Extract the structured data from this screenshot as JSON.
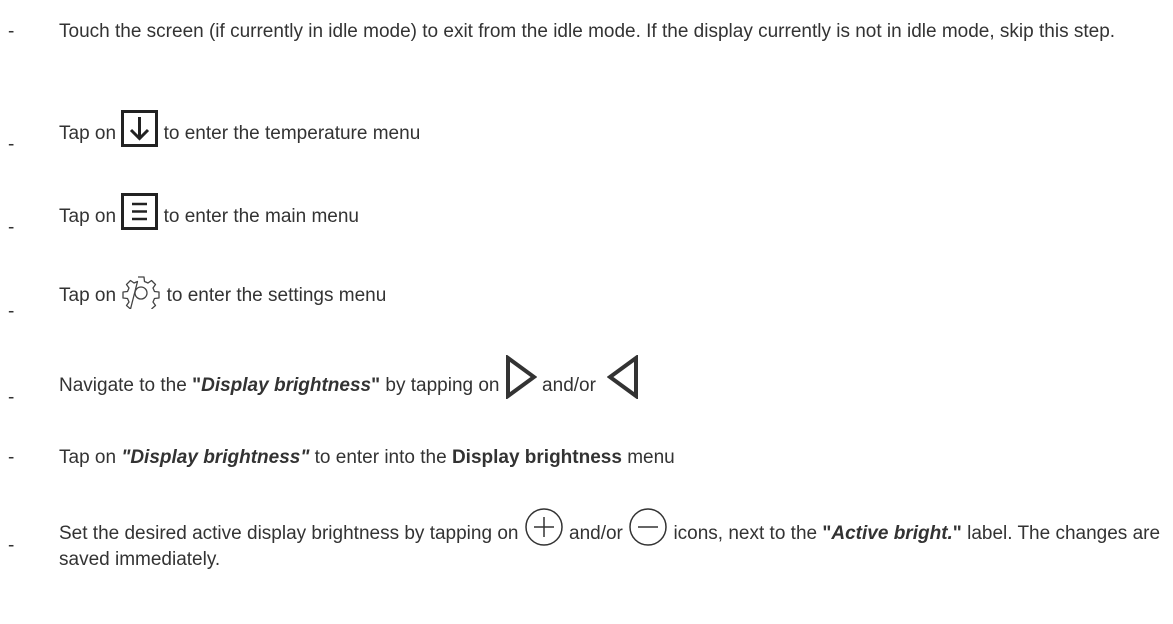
{
  "steps": [
    {
      "text": "Touch the screen (if currently in idle mode) to exit from the idle mode. If the display currently is not in idle mode, skip this step."
    },
    {
      "pre": "Tap on ",
      "icon": "arrow-down-icon",
      "post": " to enter the temperature menu"
    },
    {
      "pre": "Tap on ",
      "icon": "menu-icon",
      "post": " to enter the main menu"
    },
    {
      "pre": "Tap on ",
      "icon": "gear-icon",
      "post": " to enter the settings menu"
    },
    {
      "pre": "Navigate to the ",
      "quote_open": "\"",
      "em": "Display brightness",
      "quote_close": "\"",
      "mid": " by tapping on ",
      "icon1": "triangle-right-icon",
      "and_or": " and/or ",
      "icon2": "triangle-left-icon"
    },
    {
      "pre": "Tap on ",
      "em": "\"Display brightness\"",
      "mid": " to enter into the ",
      "bold": "Display brightness",
      "post": " menu"
    },
    {
      "pre": "Set the desired active display brightness by tapping on ",
      "icon1": "plus-circle-icon",
      "and_or": " and/or ",
      "icon2": "minus-circle-icon",
      "mid": " icons, next to the ",
      "quote_open": "\"",
      "em": "Active bright.",
      "quote_close": "\"",
      "post": " label. The changes are saved immediately."
    }
  ],
  "bullet": "-"
}
